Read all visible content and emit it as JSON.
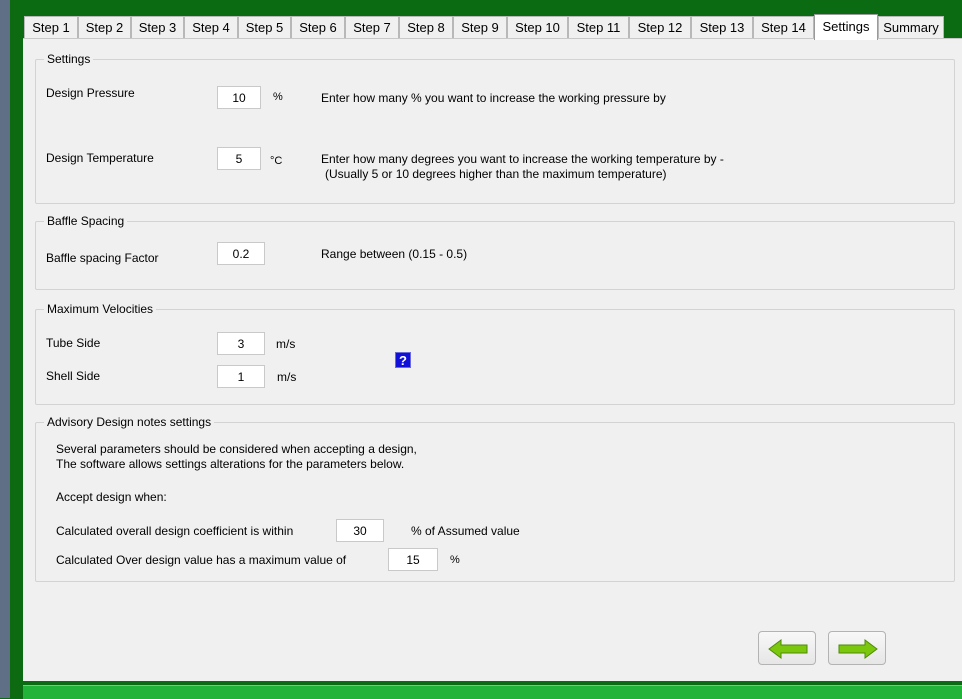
{
  "tabs": [
    {
      "label": "Step 1"
    },
    {
      "label": "Step 2"
    },
    {
      "label": "Step 3"
    },
    {
      "label": "Step 4"
    },
    {
      "label": "Step 5"
    },
    {
      "label": "Step 6"
    },
    {
      "label": "Step 7"
    },
    {
      "label": "Step 8"
    },
    {
      "label": "Step 9"
    },
    {
      "label": "Step 10"
    },
    {
      "label": "Step 11"
    },
    {
      "label": "Step 12"
    },
    {
      "label": "Step 13"
    },
    {
      "label": "Step 14"
    },
    {
      "label": "Settings",
      "active": true
    },
    {
      "label": "Summary"
    }
  ],
  "settings": {
    "legend": "Settings",
    "pressure_label": "Design Pressure",
    "pressure_value": "10",
    "pressure_unit": "%",
    "pressure_hint": "Enter how many % you want to increase the working pressure by",
    "temperature_label": "Design Temperature",
    "temperature_value": "5",
    "temperature_unit": "°C",
    "temperature_hint_line1": "Enter how many degrees you want to increase the working temperature by -",
    "temperature_hint_line2": "(Usually 5 or 10 degrees higher than the maximum temperature)"
  },
  "baffle": {
    "legend": "Baffle Spacing",
    "factor_label": "Baffle spacing Factor",
    "factor_value": "0.2",
    "range_hint": "Range between (0.15 - 0.5)"
  },
  "velocities": {
    "legend": "Maximum Velocities",
    "tube_label": "Tube Side",
    "tube_value": "3",
    "tube_unit": "m/s",
    "shell_label": "Shell Side",
    "shell_value": "1",
    "shell_unit": "m/s",
    "help_symbol": "?"
  },
  "advisory": {
    "legend": "Advisory Design notes settings",
    "note_line1": "Several parameters should be considered when accepting a design,",
    "note_line2": "The software allows settings alterations for the parameters below.",
    "accept_label": "Accept design when:",
    "coeff_label": "Calculated overall design coefficient is within",
    "coeff_value": "30",
    "coeff_unit": "% of Assumed value",
    "over_label": "Calculated Over design value has a maximum value of",
    "over_value": "15",
    "over_unit": "%"
  },
  "colors": {
    "frame_green": "#0b6b12",
    "arrow_green": "#7ac70e",
    "help_blue": "#1010d8",
    "status_green": "#22b33a"
  },
  "nav": {
    "back_icon": "arrow-left-icon",
    "next_icon": "arrow-right-icon"
  }
}
